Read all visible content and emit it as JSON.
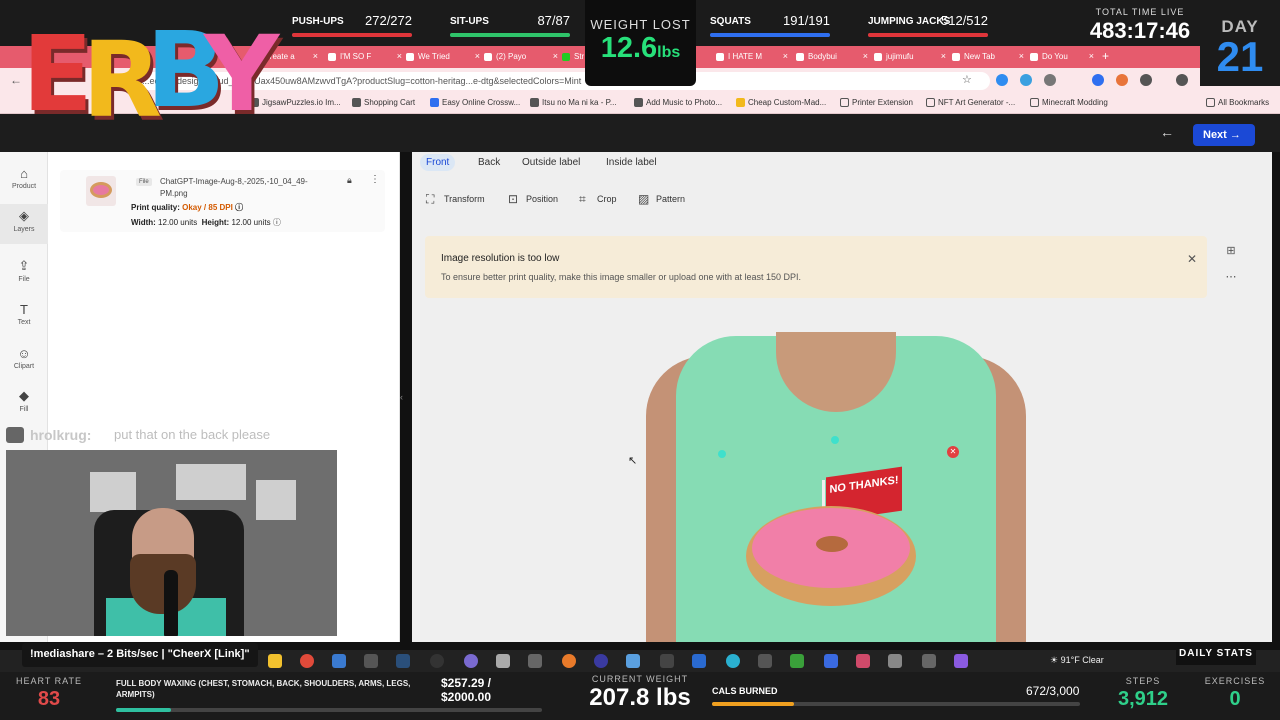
{
  "overlay": {
    "logo_letters": [
      "E",
      "R",
      "B",
      "Y"
    ],
    "logo_colors": [
      "#e23a3a",
      "#f2b91c",
      "#2aa7e0",
      "#ef5fa6"
    ],
    "stats": [
      {
        "label": "PUSH-UPS",
        "value": "272/272",
        "progress": 1.0,
        "color": "#e0353a"
      },
      {
        "label": "SIT-UPS",
        "value": "87/87",
        "progress": 1.0,
        "color": "#2fc46a"
      },
      {
        "label": "SQUATS",
        "value": "191/191",
        "progress": 1.0,
        "color": "#2f6ff0"
      },
      {
        "label": "JUMPING JACKS",
        "value": "512/512",
        "progress": 1.0,
        "color": "#e0353a"
      }
    ],
    "weight_lost": {
      "title": "WEIGHT LOST",
      "value": "12.6",
      "unit": "lbs"
    },
    "total_time": {
      "title": "TOTAL TIME LIVE",
      "value": "483:17:46"
    },
    "day": {
      "title": "DAY",
      "value": "21"
    },
    "chat": {
      "user": "hrolkrug:",
      "message": "put that on the back please"
    },
    "media_share": "!mediashare – 2 Bits/sec | \"CheerX [Link]\"",
    "daily_stats": "DAILY STATS",
    "weather": "91°F  Clear",
    "bottom": {
      "heart_rate": {
        "title": "HEART RATE",
        "value": "83"
      },
      "waxing": {
        "label": "FULL BODY WAXING (CHEST, STOMACH, BACK, SHOULDERS, ARMS, LEGS, ARMPITS)",
        "amount": "$257.29 / $2000.00",
        "progress": 0.129
      },
      "current_weight": {
        "title": "CURRENT WEIGHT",
        "value": "207.8 lbs"
      },
      "cals": {
        "label": "CALS BURNED",
        "value": "672/3,000",
        "progress": 0.224
      },
      "steps": {
        "title": "STEPS",
        "value": "3,912"
      },
      "exercises": {
        "title": "EXERCISES",
        "value": "0"
      }
    }
  },
  "browser": {
    "tabs": [
      "Create a",
      "I'M SO F",
      "We Tried",
      "(2) Payo",
      "Str",
      "I HATE M",
      "Bodybui",
      "jujimufu",
      "New Tab",
      "Do You"
    ],
    "url": "...edded/designer/cud_bLZ_Uax450uw8AMzwvdTgA?productSlug=cotton-heritag...e-dtg&selectedColors=Mint",
    "bookmarks": [
      "JigsawPuzzles.io Im...",
      "Shopping Cart",
      "Easy Online Crossw...",
      "Itsu no Ma ni ka - P...",
      "Add Music to Photo...",
      "Cheap Custom-Mad...",
      "Printer Extension",
      "NFT Art Generator -...",
      "Minecraft Modding",
      "All Bookmarks"
    ]
  },
  "app": {
    "next_label": "Next",
    "rail": [
      {
        "icon": "shirt-icon",
        "glyph": "⌂",
        "label": "Product"
      },
      {
        "icon": "layers-icon",
        "glyph": "◈",
        "label": "Layers"
      },
      {
        "icon": "upload-icon",
        "glyph": "⇪",
        "label": "File"
      },
      {
        "icon": "text-icon",
        "glyph": "T",
        "label": "Text"
      },
      {
        "icon": "clipart-icon",
        "glyph": "☺",
        "label": "Clipart"
      },
      {
        "icon": "fill-icon",
        "glyph": "◆",
        "label": "Fill"
      }
    ],
    "layer": {
      "tag": "File",
      "filename": "ChatGPT-Image-Aug-8,-2025,-10_04_49-PM.png",
      "print_quality_label": "Print quality:",
      "print_quality_value": "Okay / 85 DPI",
      "width_label": "Width:",
      "width_value": "12.00 units",
      "height_label": "Height:",
      "height_value": "12.00 units"
    },
    "view_tabs": [
      "Front",
      "Back",
      "Outside label",
      "Inside label"
    ],
    "tools": [
      {
        "icon": "transform-icon",
        "glyph": "⛶",
        "label": "Transform"
      },
      {
        "icon": "position-icon",
        "glyph": "⊡",
        "label": "Position"
      },
      {
        "icon": "crop-icon",
        "glyph": "⌗",
        "label": "Crop"
      },
      {
        "icon": "pattern-icon",
        "glyph": "▨",
        "label": "Pattern"
      }
    ],
    "notice": {
      "title": "Image resolution is too low",
      "body": "To ensure better print quality, make this image smaller or upload one with at least 150 DPI."
    },
    "design_text": "NO THANKS!",
    "colors": {
      "accent": "#1b49d6",
      "shirt": "#86dcb4",
      "notice_bg": "#f6ecd8",
      "warning": "#d35a00"
    }
  }
}
